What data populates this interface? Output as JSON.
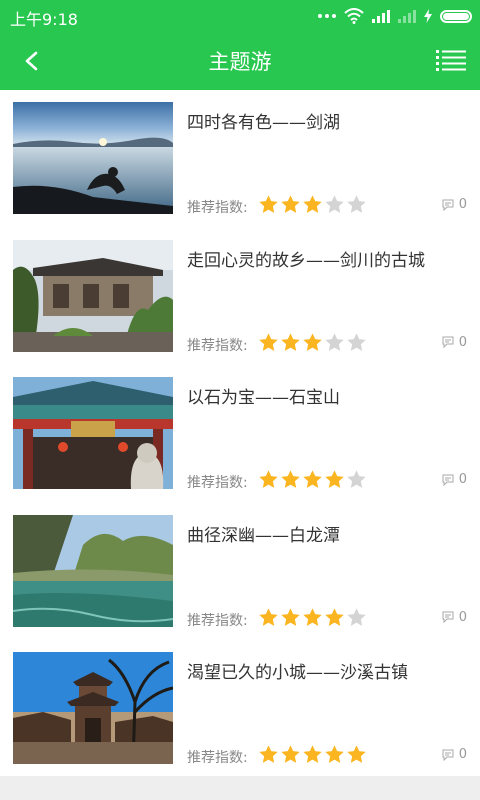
{
  "status_bar": {
    "time": "上午9:18",
    "icons": [
      "more-dots-icon",
      "wifi-icon",
      "signal-icon",
      "signal-weak-icon",
      "charging-icon",
      "battery-icon"
    ]
  },
  "header": {
    "title": "主题游",
    "back_icon": "chevron-left-icon",
    "menu_icon": "list-menu-icon",
    "color": "#28c850"
  },
  "list": {
    "rating_label": "推荐指数:",
    "items": [
      {
        "title": "四时各有色——剑湖",
        "stars": 3,
        "max_stars": 5,
        "comments": "0",
        "image": "lake-sunset-photo"
      },
      {
        "title": "走回心灵的故乡——剑川的古城",
        "stars": 3,
        "max_stars": 5,
        "comments": "0",
        "image": "ancient-courtyard-photo"
      },
      {
        "title": "以石为宝——石宝山",
        "stars": 4,
        "max_stars": 5,
        "comments": "0",
        "image": "temple-gate-photo"
      },
      {
        "title": "曲径深幽——白龙潭",
        "stars": 4,
        "max_stars": 5,
        "comments": "0",
        "image": "green-pond-photo"
      },
      {
        "title": "渴望已久的小城——沙溪古镇",
        "stars": 5,
        "max_stars": 5,
        "comments": "0",
        "image": "old-town-tower-photo"
      }
    ]
  },
  "colors": {
    "star_on": "#fbb520",
    "star_off": "#d4d4d4",
    "text": "#333333",
    "muted": "#888888"
  }
}
